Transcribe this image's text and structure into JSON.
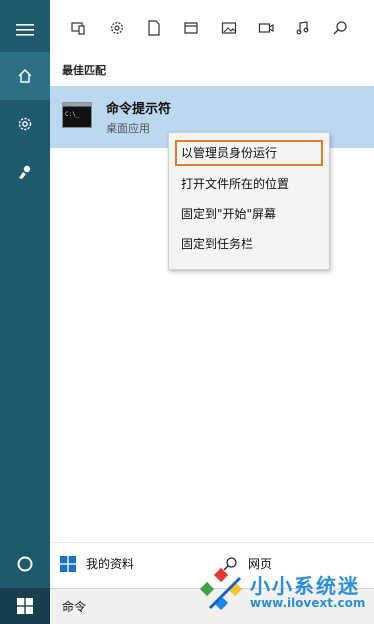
{
  "filters": {
    "icons": [
      "tablet-icon",
      "gear-icon",
      "document-icon",
      "folder-icon",
      "image-icon",
      "video-icon",
      "music-icon",
      "search-icon"
    ]
  },
  "section_title": "最佳匹配",
  "result": {
    "name": "命令提示符",
    "subtitle": "桌面应用"
  },
  "context_menu": {
    "items": [
      "以管理员身份运行",
      "打开文件所在的位置",
      "固定到\"开始\"屏幕",
      "固定到任务栏"
    ],
    "highlight_color": "#e47a2c"
  },
  "bottom": {
    "my_stuff": "我的资料",
    "web": "网页"
  },
  "search": {
    "value": "命令"
  },
  "watermark": {
    "title": "小小系统迷",
    "url": "www.ilovext.com"
  },
  "colors": {
    "rail": "#1e5a6e",
    "selection": "#bcd8f0",
    "accent": "#2a8fd6"
  }
}
